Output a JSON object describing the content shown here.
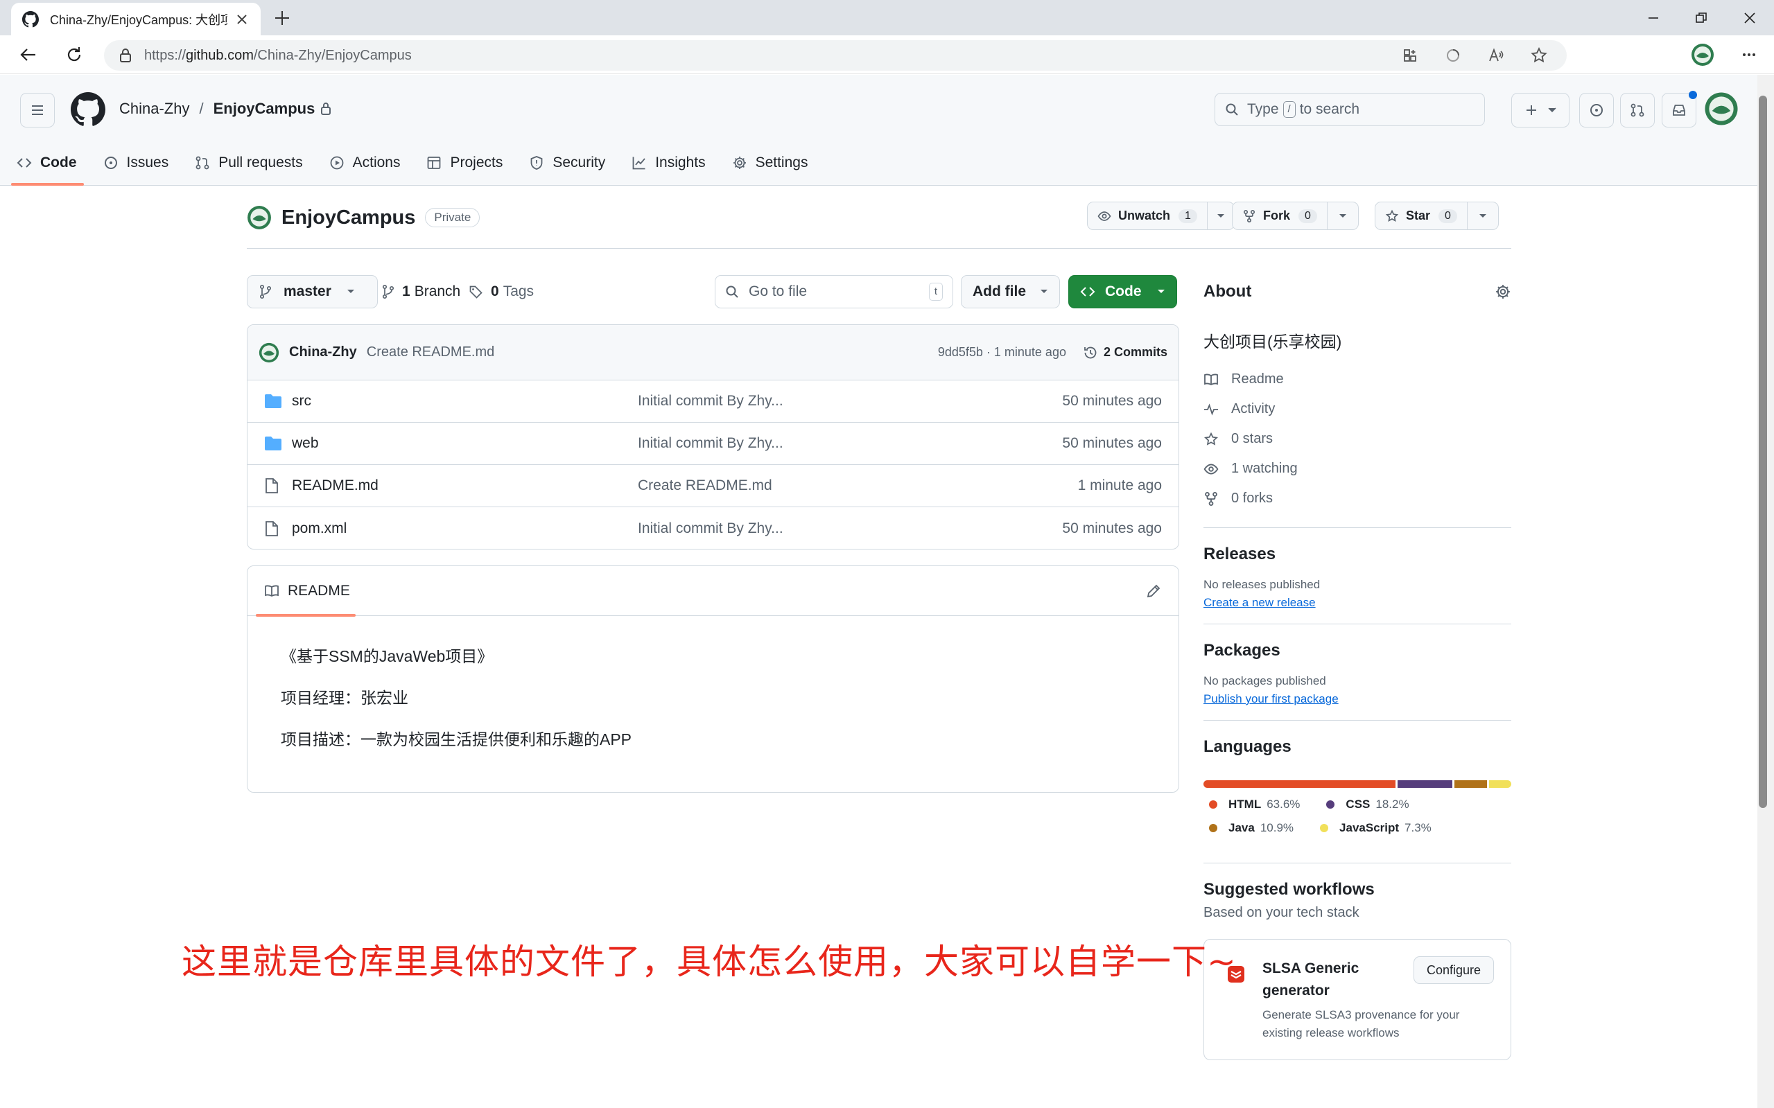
{
  "browser": {
    "tab_title": "China-Zhy/EnjoyCampus: 大创项目",
    "url_prefix": "https://",
    "url_host": "github.com",
    "url_path": "/China-Zhy/EnjoyCampus"
  },
  "header": {
    "owner": "China-Zhy",
    "separator": "/",
    "repo": "EnjoyCampus",
    "search_type": "Type",
    "search_key": "/",
    "search_rest": "to search"
  },
  "repo_nav": [
    {
      "label": "Code",
      "icon": "code-icon"
    },
    {
      "label": "Issues",
      "icon": "issue-icon"
    },
    {
      "label": "Pull requests",
      "icon": "pull-request-icon"
    },
    {
      "label": "Actions",
      "icon": "play-icon"
    },
    {
      "label": "Projects",
      "icon": "table-icon"
    },
    {
      "label": "Security",
      "icon": "shield-icon"
    },
    {
      "label": "Insights",
      "icon": "graph-icon"
    },
    {
      "label": "Settings",
      "icon": "gear-icon"
    }
  ],
  "repo": {
    "name": "EnjoyCampus",
    "visibility": "Private",
    "watch_label": "Unwatch",
    "watch_count": "1",
    "fork_label": "Fork",
    "fork_count": "0",
    "star_label": "Star",
    "star_count": "0"
  },
  "file_toolbar": {
    "branch": "master",
    "branch_count": "1",
    "branch_label": "Branch",
    "tag_count": "0",
    "tag_label": "Tags",
    "goto_placeholder": "Go to file",
    "goto_key": "t",
    "add_file": "Add file",
    "code": "Code"
  },
  "latest_commit": {
    "author": "China-Zhy",
    "message": "Create README.md",
    "hash_time": "9dd5f5b · 1 minute ago",
    "commits": "2 Commits"
  },
  "files": [
    {
      "name": "src",
      "type": "folder",
      "message": "Initial commit By Zhy...",
      "time": "50 minutes ago"
    },
    {
      "name": "web",
      "type": "folder",
      "message": "Initial commit By Zhy...",
      "time": "50 minutes ago"
    },
    {
      "name": "README.md",
      "type": "file",
      "message": "Create README.md",
      "time": "1 minute ago"
    },
    {
      "name": "pom.xml",
      "type": "file",
      "message": "Initial commit By Zhy...",
      "time": "50 minutes ago"
    }
  ],
  "readme": {
    "tab_label": "README",
    "lines": [
      "《基于SSM的JavaWeb项目》",
      "项目经理：张宏业",
      "项目描述：一款为校园生活提供便利和乐趣的APP"
    ]
  },
  "about": {
    "heading": "About",
    "description": "大创项目(乐享校园)",
    "links": [
      {
        "label": "Readme",
        "icon": "book-icon"
      },
      {
        "label": "Activity",
        "icon": "pulse-icon"
      },
      {
        "label": "0 stars",
        "icon": "star-icon"
      },
      {
        "label": "1 watching",
        "icon": "eye-icon"
      },
      {
        "label": "0 forks",
        "icon": "fork-icon"
      }
    ]
  },
  "releases": {
    "heading": "Releases",
    "empty": "No releases published",
    "link": "Create a new release"
  },
  "packages": {
    "heading": "Packages",
    "empty": "No packages published",
    "link": "Publish your first package"
  },
  "languages": {
    "heading": "Languages",
    "items": [
      {
        "name": "HTML",
        "percent": "63.6%",
        "value": 63.6,
        "color": "#e34c26"
      },
      {
        "name": "CSS",
        "percent": "18.2%",
        "value": 18.2,
        "color": "#563d7c"
      },
      {
        "name": "Java",
        "percent": "10.9%",
        "value": 10.9,
        "color": "#b07219"
      },
      {
        "name": "JavaScript",
        "percent": "7.3%",
        "value": 7.3,
        "color": "#f1e05a"
      }
    ]
  },
  "workflows": {
    "heading": "Suggested workflows",
    "subheading": "Based on your tech stack",
    "card_title": "SLSA Generic generator",
    "card_desc": "Generate SLSA3 provenance for your existing release workflows",
    "configure": "Configure"
  },
  "annotation": "这里就是仓库里具体的文件了，具体怎么使用，大家可以自学一下~"
}
